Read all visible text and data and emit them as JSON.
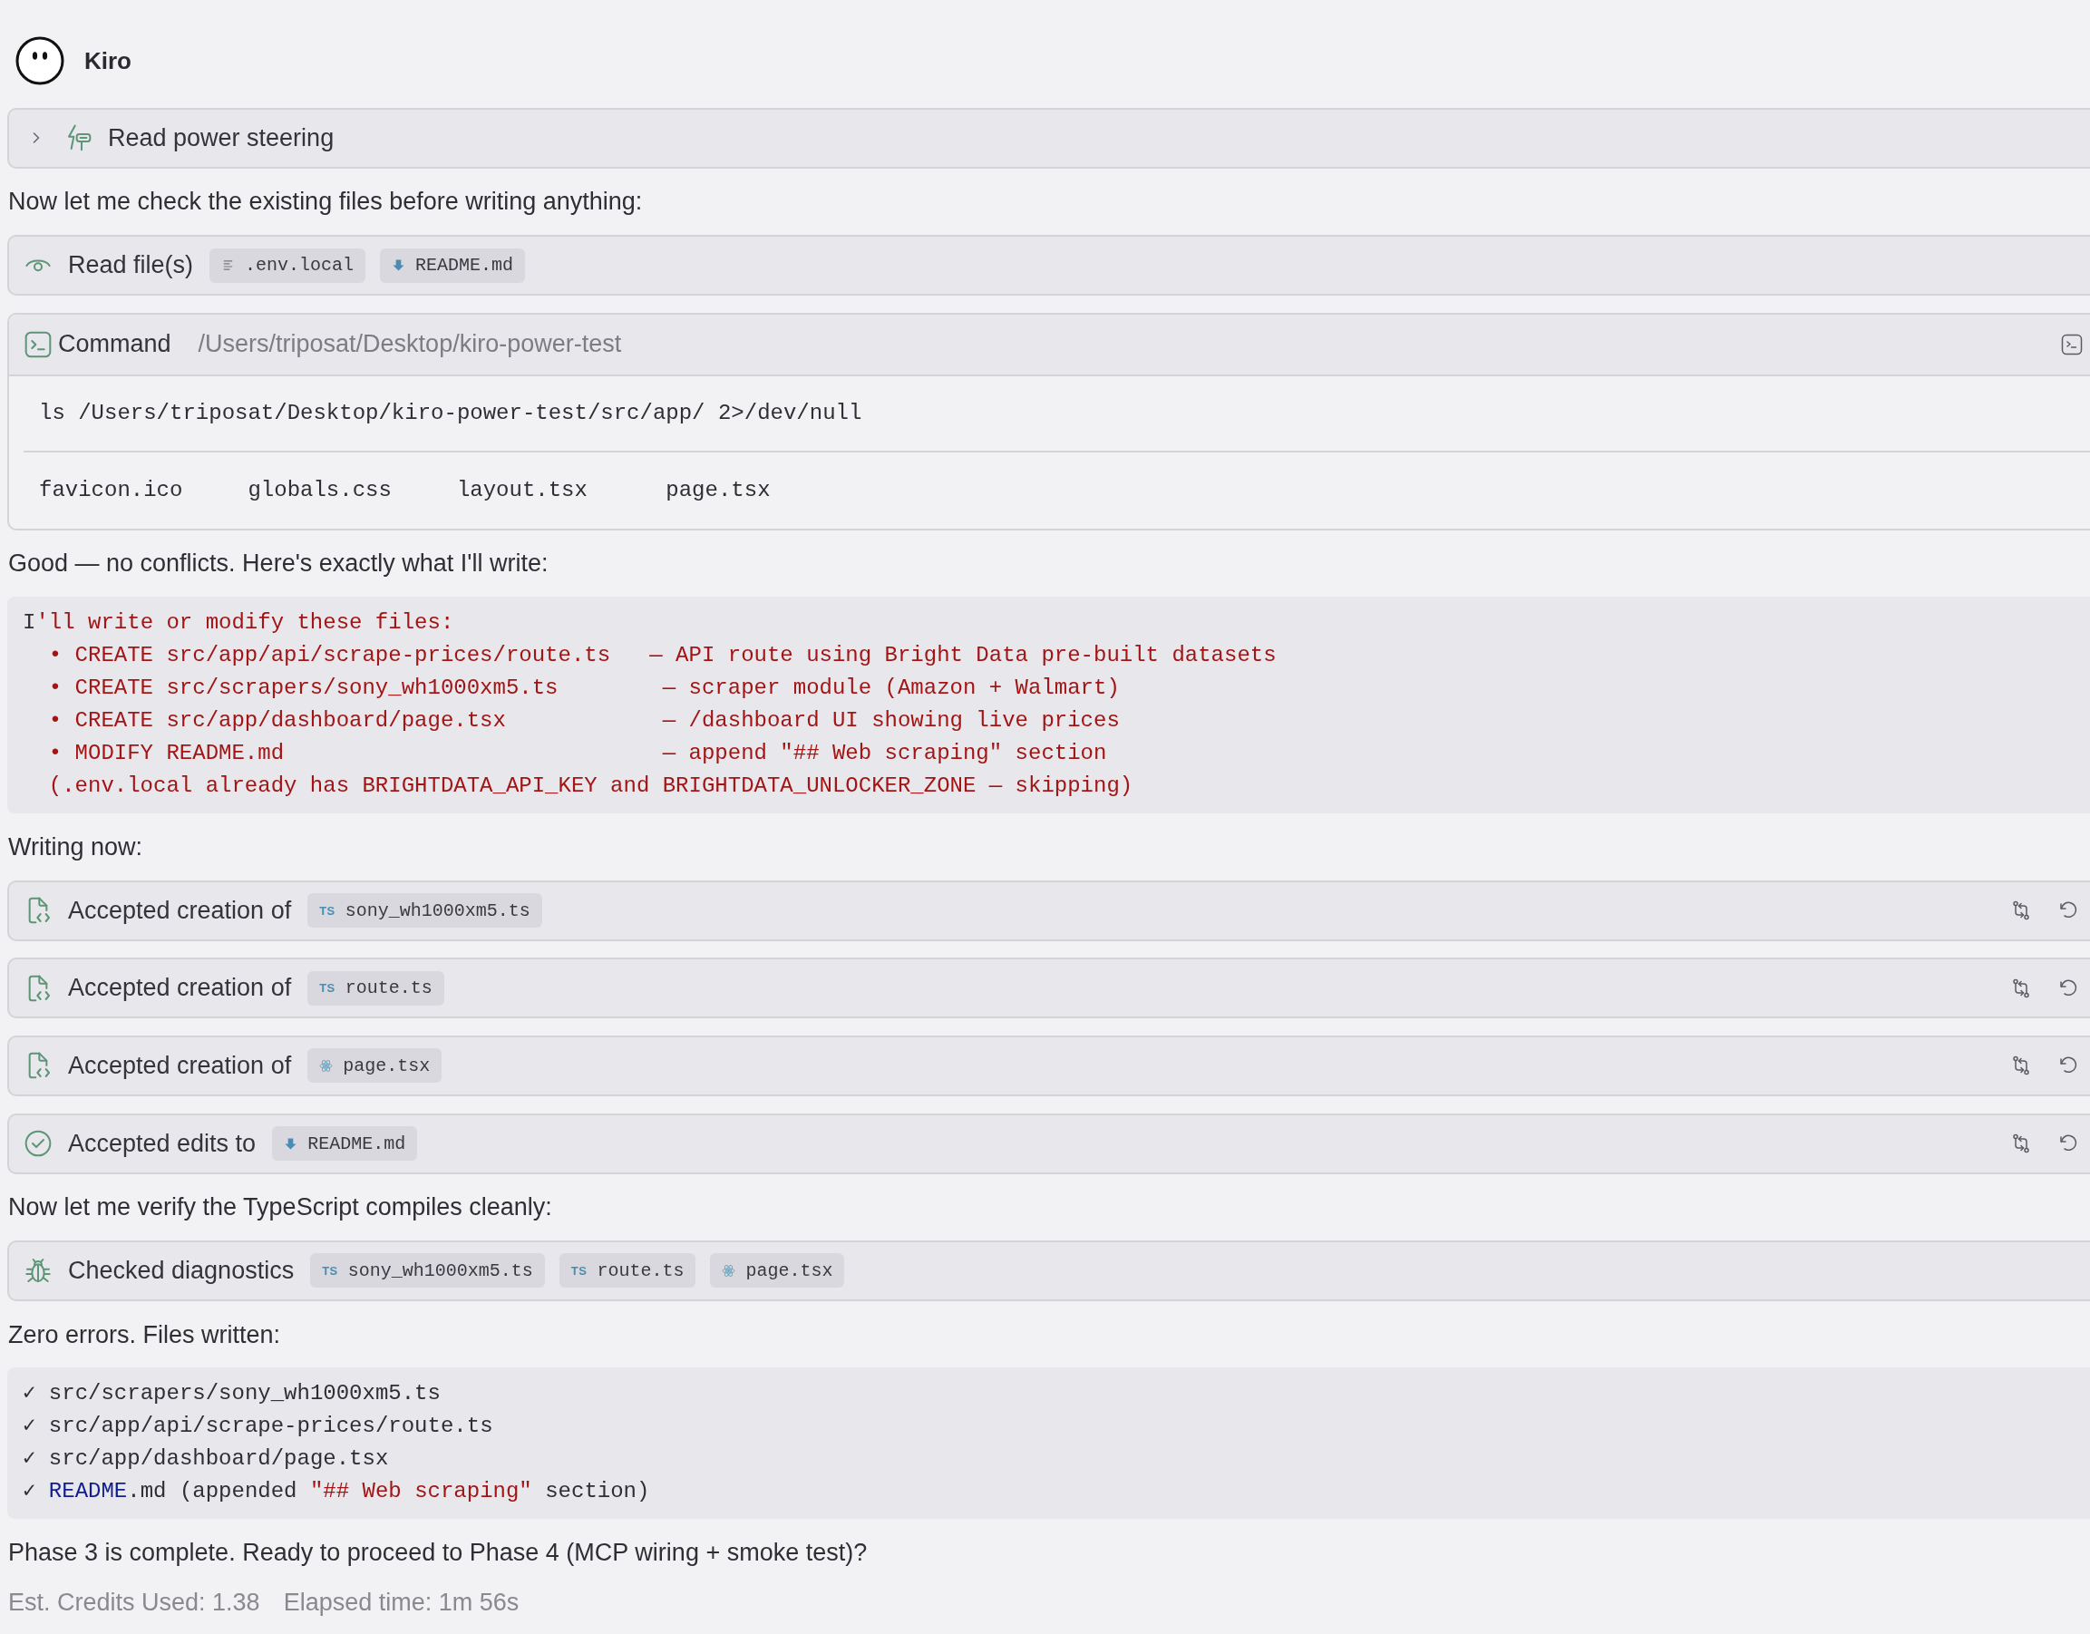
{
  "header": {
    "name": "Kiro"
  },
  "items": [
    {
      "kind": "steering_read",
      "label": "Read power steering",
      "expanded": false,
      "undoable": false
    },
    {
      "kind": "text",
      "text": "Now let me check the existing files before writing anything:"
    },
    {
      "kind": "file_read",
      "label": "Read file(s)",
      "undoable": false,
      "files": [
        {
          "kind": "text",
          "name": ".env.local"
        },
        {
          "kind": "markdown",
          "name": "README.md"
        }
      ]
    },
    {
      "kind": "command",
      "label": "Command",
      "cwd": "/Users/triposat/Desktop/kiro-power-test",
      "command": "ls /Users/triposat/Desktop/kiro-power-test/src/app/ 2>/dev/null",
      "output": "favicon.ico     globals.css     layout.tsx      page.tsx"
    },
    {
      "kind": "text",
      "text": "Good — no conflicts. Here's exactly what I'll write:"
    },
    {
      "kind": "code",
      "lines": [
        {
          "tokens": [
            {
              "kind": "plain",
              "text": "I"
            },
            {
              "kind": "string",
              "text": "'ll write or modify these files:"
            }
          ]
        },
        {
          "tokens": [
            {
              "kind": "string",
              "text": "  • CREATE src/app/api/scrape-prices/route.ts   — API route using Bright Data pre-built datasets"
            }
          ]
        },
        {
          "tokens": [
            {
              "kind": "string",
              "text": "  • CREATE src/scrapers/sony_wh1000xm5.ts        — scraper module (Amazon + Walmart)"
            }
          ]
        },
        {
          "tokens": [
            {
              "kind": "string",
              "text": "  • CREATE src/app/dashboard/page.tsx            — /dashboard UI showing live prices"
            }
          ]
        },
        {
          "tokens": [
            {
              "kind": "string",
              "text": "  • MODIFY README.md                             — append \"## Web scraping\" section"
            }
          ]
        },
        {
          "tokens": [
            {
              "kind": "string",
              "text": "  (.env.local already has BRIGHTDATA_API_KEY and BRIGHTDATA_UNLOCKER_ZONE — skipping)"
            }
          ]
        }
      ]
    },
    {
      "kind": "text",
      "text": "Writing now:"
    },
    {
      "kind": "file_created",
      "label": "Accepted creation of",
      "undoable": true,
      "files": [
        {
          "kind": "typescript",
          "badge": "TS",
          "name": "sony_wh1000xm5.ts"
        }
      ]
    },
    {
      "kind": "file_created",
      "label": "Accepted creation of",
      "undoable": true,
      "files": [
        {
          "kind": "typescript",
          "badge": "TS",
          "name": "route.ts"
        }
      ]
    },
    {
      "kind": "file_created",
      "label": "Accepted creation of",
      "undoable": true,
      "files": [
        {
          "kind": "react",
          "name": "page.tsx"
        }
      ]
    },
    {
      "kind": "file_edited",
      "label": "Accepted edits to",
      "undoable": true,
      "files": [
        {
          "kind": "markdown",
          "name": "README.md"
        }
      ]
    },
    {
      "kind": "text",
      "text": "Now let me verify the TypeScript compiles cleanly:"
    },
    {
      "kind": "diagnostics",
      "label": "Checked diagnostics",
      "undoable": false,
      "files": [
        {
          "kind": "typescript",
          "badge": "TS",
          "name": "sony_wh1000xm5.ts"
        },
        {
          "kind": "typescript",
          "badge": "TS",
          "name": "route.ts"
        },
        {
          "kind": "react",
          "name": "page.tsx"
        }
      ]
    },
    {
      "kind": "text",
      "text": "Zero errors. Files written:"
    },
    {
      "kind": "code",
      "lines": [
        {
          "tokens": [
            {
              "kind": "plain",
              "text": "✓ src/scrapers/sony_wh1000xm5.ts"
            }
          ]
        },
        {
          "tokens": [
            {
              "kind": "plain",
              "text": "✓ src/app/api/scrape-prices/route.ts"
            }
          ]
        },
        {
          "tokens": [
            {
              "kind": "plain",
              "text": "✓ src/app/dashboard/page.tsx"
            }
          ]
        },
        {
          "tokens": [
            {
              "kind": "plain",
              "text": "✓ "
            },
            {
              "kind": "identifier",
              "text": "README"
            },
            {
              "kind": "plain",
              "text": ".md (appended "
            },
            {
              "kind": "string",
              "text": "\"## Web scraping\""
            },
            {
              "kind": "plain",
              "text": " section)"
            }
          ]
        }
      ]
    },
    {
      "kind": "text",
      "text": "Phase 3 is complete. Ready to proceed to Phase 4 (MCP wiring + smoke test)?"
    }
  ],
  "footer": {
    "credits": "Est. Credits Used: 1.38",
    "elapsed": "Elapsed time: 1m 56s"
  }
}
